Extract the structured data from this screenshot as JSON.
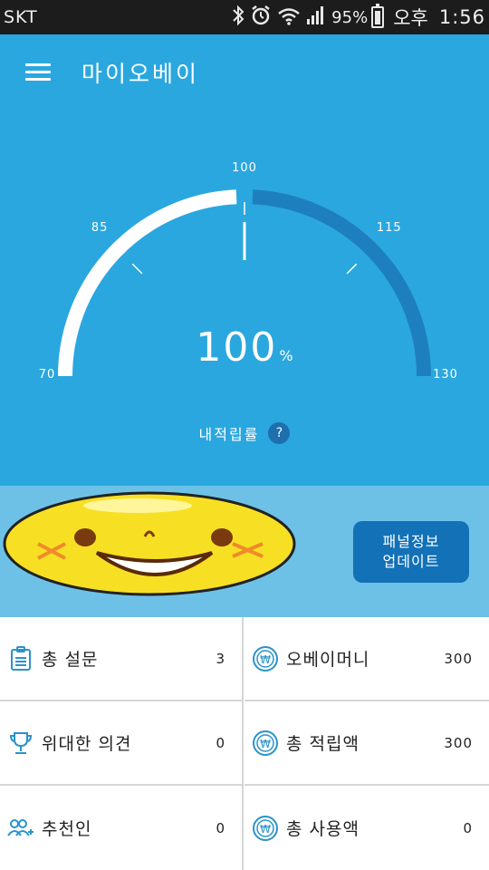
{
  "status_bar": {
    "carrier": "SKT",
    "battery_percent": "95%",
    "ampm": "오후",
    "time": "1:56"
  },
  "header": {
    "title": "마이오베이"
  },
  "gauge": {
    "value": 100,
    "value_text": "100",
    "unit": "%",
    "min": 70,
    "max": 130,
    "ticks": [
      "70",
      "85",
      "100",
      "115",
      "130"
    ],
    "label": "내적립률",
    "help": "?",
    "colors": {
      "filled": "#ffffff",
      "remaining": "#1e7fbf"
    }
  },
  "banner": {
    "update_button_line1": "패널정보",
    "update_button_line2": "업데이트"
  },
  "stats": {
    "surveys": {
      "label": "총 설문",
      "value": "3",
      "icon": "clipboard-icon"
    },
    "obey_money": {
      "label": "오베이머니",
      "value": "300",
      "icon": "won-coin-icon"
    },
    "great_opinions": {
      "label": "위대한 의견",
      "value": "0",
      "icon": "trophy-icon"
    },
    "total_earned": {
      "label": "총 적립액",
      "value": "300",
      "icon": "won-coin-icon"
    },
    "referrals": {
      "label": "추천인",
      "value": "0",
      "icon": "add-people-icon"
    },
    "total_used": {
      "label": "총 사용액",
      "value": "0",
      "icon": "won-coin-icon"
    }
  },
  "colors": {
    "primary": "#2aa7df",
    "banner": "#6dc1e7",
    "button": "#1271b7",
    "icon": "#2a93c9"
  }
}
